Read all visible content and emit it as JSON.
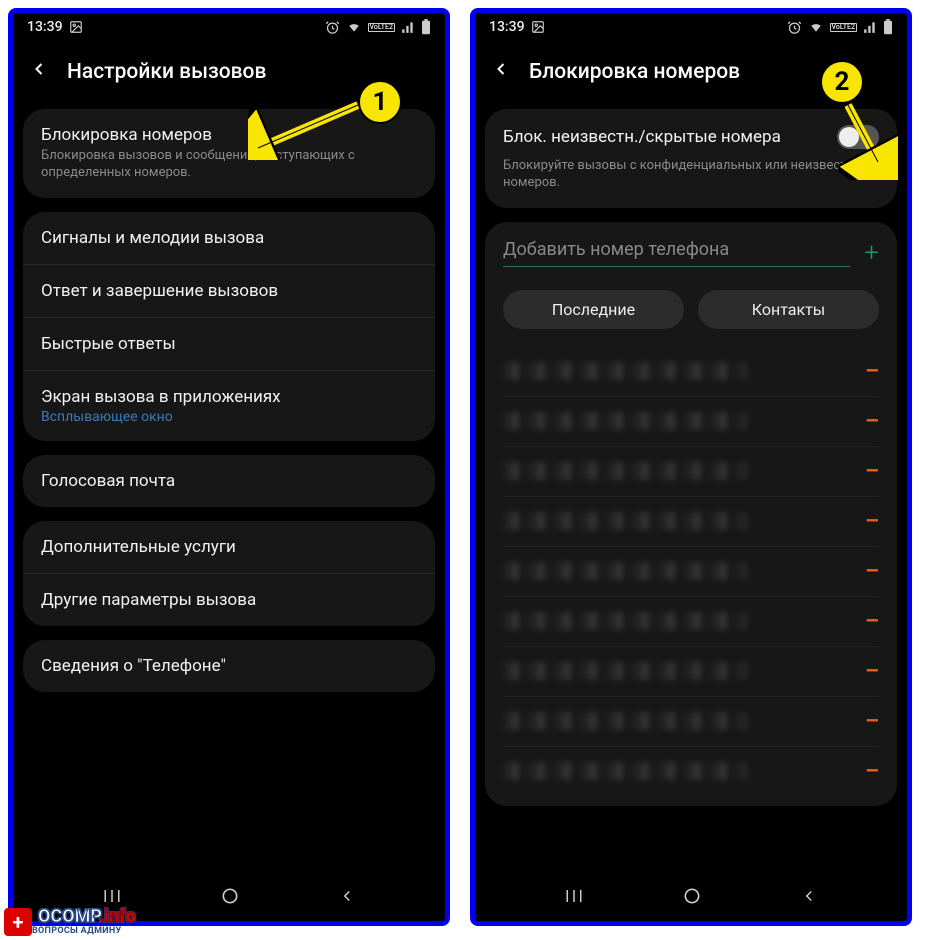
{
  "status": {
    "time": "13:39"
  },
  "annotations": {
    "badge1": "1",
    "badge2": "2"
  },
  "watermark": {
    "brand1": "OCOMP",
    "brand2": ".info",
    "sub": "ВОПРОСЫ АДМИНУ",
    "plus": "+"
  },
  "screen1": {
    "title": "Настройки вызовов",
    "group1": {
      "item0": {
        "title": "Блокировка номеров",
        "sub": "Блокировка вызовов и сообщений, поступающих с определенных номеров."
      }
    },
    "group2": {
      "item0": {
        "title": "Сигналы и мелодии вызова"
      },
      "item1": {
        "title": "Ответ и завершение вызовов"
      },
      "item2": {
        "title": "Быстрые ответы"
      },
      "item3": {
        "title": "Экран вызова в приложениях",
        "link": "Всплывающее окно"
      }
    },
    "group3": {
      "item0": {
        "title": "Голосовая почта"
      }
    },
    "group4": {
      "item0": {
        "title": "Дополнительные услуги"
      },
      "item1": {
        "title": "Другие параметры вызова"
      }
    },
    "group5": {
      "item0": {
        "title": "Сведения о \"Телефоне\""
      }
    }
  },
  "screen2": {
    "title": "Блокировка номеров",
    "toggle": {
      "title": "Блок. неизвестн./скрытые номера",
      "sub": "Блокируйте вызовы с конфиденциальных или неизвестных номеров."
    },
    "input": {
      "placeholder": "Добавить номер телефона"
    },
    "tabs": {
      "recent": "Последние",
      "contacts": "Контакты"
    },
    "blocked_count": 9
  }
}
